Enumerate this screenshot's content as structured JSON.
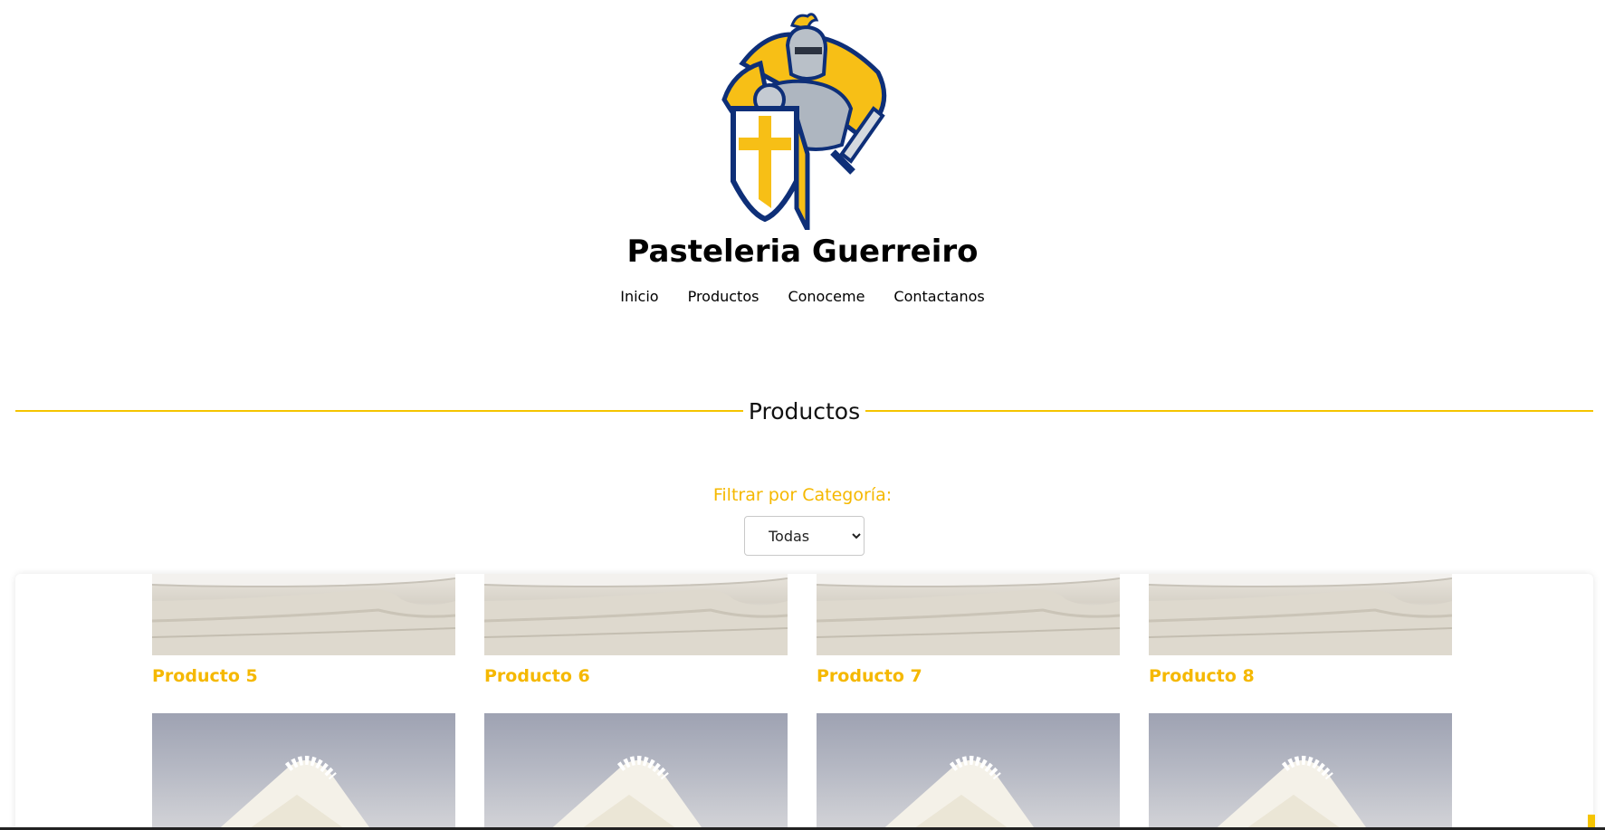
{
  "site": {
    "title": "Pasteleria Guerreiro"
  },
  "nav": {
    "items": [
      "Inicio",
      "Productos",
      "Conoceme",
      "Contactanos"
    ]
  },
  "section": {
    "heading": "Productos"
  },
  "filter": {
    "label": "Filtrar por Categoría:",
    "selected": "Todas"
  },
  "products": [
    {
      "name": "Producto 5"
    },
    {
      "name": "Producto 6"
    },
    {
      "name": "Producto 7"
    },
    {
      "name": "Producto 8"
    }
  ],
  "colors": {
    "accent": "#f5c400",
    "product_name": "#f5b800",
    "knight_blue": "#0e2f78"
  },
  "icons": {
    "logo": "knight-mascot-logo",
    "select_arrow": "chevron-down-icon"
  }
}
